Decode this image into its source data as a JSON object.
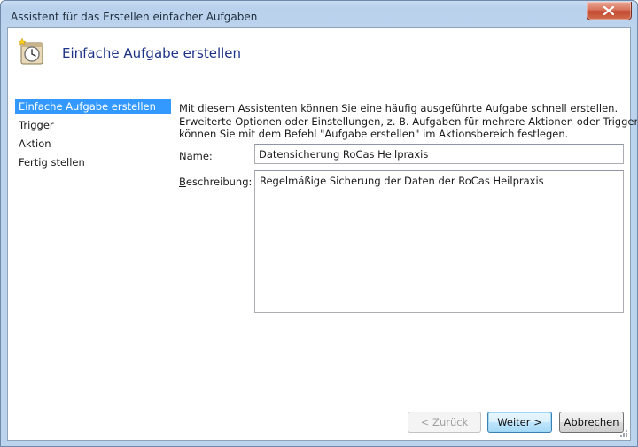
{
  "window": {
    "title": "Assistent für das Erstellen einfacher Aufgaben"
  },
  "header": {
    "title": "Einfache Aufgabe erstellen",
    "icon": "clock-wizard-icon"
  },
  "sidebar": {
    "items": [
      {
        "label": "Einfache Aufgabe erstellen",
        "active": true
      },
      {
        "label": "Trigger",
        "active": false
      },
      {
        "label": "Aktion",
        "active": false
      },
      {
        "label": "Fertig stellen",
        "active": false
      }
    ]
  },
  "intro": {
    "line1": "Mit diesem Assistenten können Sie eine häufig ausgeführte Aufgabe schnell erstellen.",
    "line2": "Erweiterte Optionen oder Einstellungen, z. B. Aufgaben für mehrere Aktionen oder Trigger,",
    "line3": "können Sie mit dem Befehl \"Aufgabe erstellen\" im Aktionsbereich festlegen."
  },
  "form": {
    "name_label_u": "N",
    "name_label_rest": "ame:",
    "name_value": "Datensicherung RoCas Heilpraxis",
    "desc_label_u": "B",
    "desc_label_rest": "eschreibung:",
    "desc_value": "Regelmäßige Sicherung der Daten der RoCas Heilpraxis"
  },
  "buttons": {
    "back_pre": "< ",
    "back_u": "Z",
    "back_rest": "urück",
    "next_u": "W",
    "next_rest": "eiter >",
    "cancel": "Abbrechen"
  }
}
